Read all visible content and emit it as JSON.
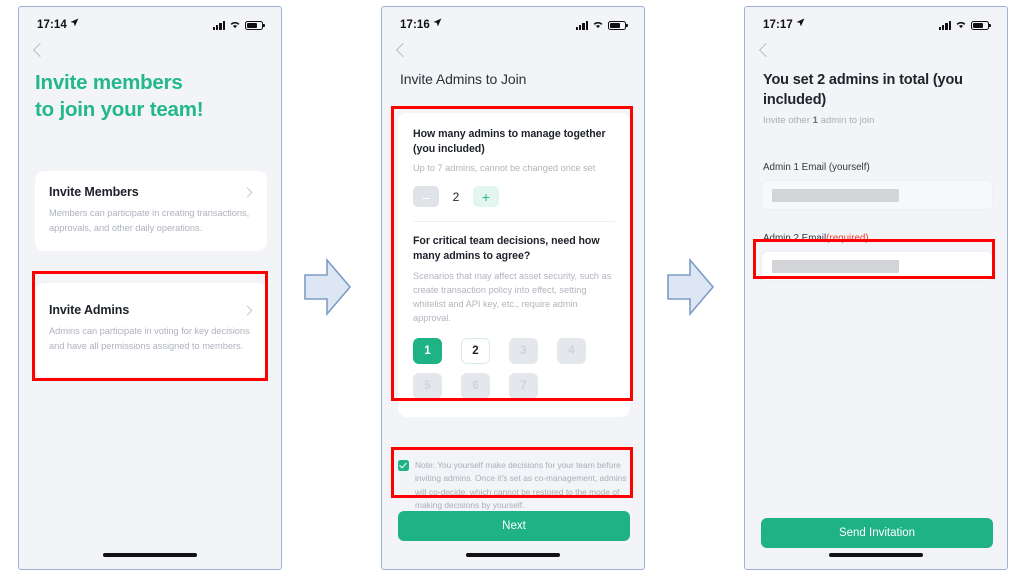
{
  "screens": [
    {
      "id": "invite-members",
      "statusbar": {
        "time": "17:14",
        "location_icon": "location-arrow-icon",
        "signal_icon": "cellular-signal-icon",
        "wifi_icon": "wifi-icon",
        "battery_icon": "battery-icon"
      },
      "back_icon": "chevron-left-icon",
      "hero_line1": "Invite members",
      "hero_line2": "to join your team!",
      "cards": [
        {
          "title": "Invite Members",
          "desc": "Members can participate in creating transactions, approvals, and other daily operations.",
          "chevron_icon": "chevron-right-icon",
          "highlighted": false
        },
        {
          "title": "Invite Admins",
          "desc": "Admins can participate in voting for key decisions and have all permissions assigned to members.",
          "chevron_icon": "chevron-right-icon",
          "highlighted": true
        }
      ]
    },
    {
      "id": "invite-admins-to-join",
      "statusbar": {
        "time": "17:16",
        "location_icon": "location-arrow-icon",
        "signal_icon": "cellular-signal-icon",
        "wifi_icon": "wifi-icon",
        "battery_icon": "battery-icon"
      },
      "back_icon": "chevron-left-icon",
      "title": "Invite Admins to Join",
      "question1": {
        "title": "How many admins to manage together (you included)",
        "desc": "Up to 7 admins, cannot be changed once set",
        "minus_label": "–",
        "value": "2",
        "plus_label": "+"
      },
      "question2": {
        "title": "For critical team decisions, need how many admins to agree?",
        "desc": "Scenarios that may affect asset security, such as create transaction policy into effect, setting whitelist and API key, etc., require admin approval.",
        "options": [
          {
            "label": "1",
            "state": "selected"
          },
          {
            "label": "2",
            "state": "available"
          },
          {
            "label": "3",
            "state": "disabled"
          },
          {
            "label": "4",
            "state": "disabled"
          },
          {
            "label": "5",
            "state": "disabled"
          },
          {
            "label": "6",
            "state": "disabled"
          },
          {
            "label": "7",
            "state": "disabled"
          }
        ]
      },
      "note": {
        "checkbox_icon": "checkbox-checked-icon",
        "checked": true,
        "text": "Note: You yourself make decisions for your team before inviting admins. Once it's set as co-management, admins will co-decide, which cannot be restored to the mode of making decisions by yourself."
      },
      "primary_button": "Next"
    },
    {
      "id": "set-admins-total",
      "statusbar": {
        "time": "17:17",
        "location_icon": "location-arrow-icon",
        "signal_icon": "cellular-signal-icon",
        "wifi_icon": "wifi-icon",
        "battery_icon": "battery-icon"
      },
      "back_icon": "chevron-left-icon",
      "title": "You set 2 admins in total (you included)",
      "subtitle_pre": "Invite other ",
      "subtitle_count": "1",
      "subtitle_post": " admin to join",
      "fields": [
        {
          "label": "Admin 1 Email (yourself)",
          "required_label": "",
          "value_redacted": true,
          "state": "filled",
          "highlighted": false
        },
        {
          "label": "Admin 2 Email",
          "required_label": "(required)",
          "value_redacted": true,
          "state": "empty",
          "highlighted": true
        }
      ],
      "primary_button": "Send Invitation"
    }
  ],
  "flow": {
    "arrow1_icon": "right-arrow-shape",
    "arrow2_icon": "right-arrow-shape"
  },
  "colors": {
    "accent_green": "#1fb284",
    "hero_green": "#22b88b",
    "annotation_red": "#ff0000",
    "required_red": "#f0392e",
    "screen_bg": "#f2f4f8",
    "arrow_fill": "#dde6f3",
    "arrow_stroke": "#7e9cc7"
  }
}
